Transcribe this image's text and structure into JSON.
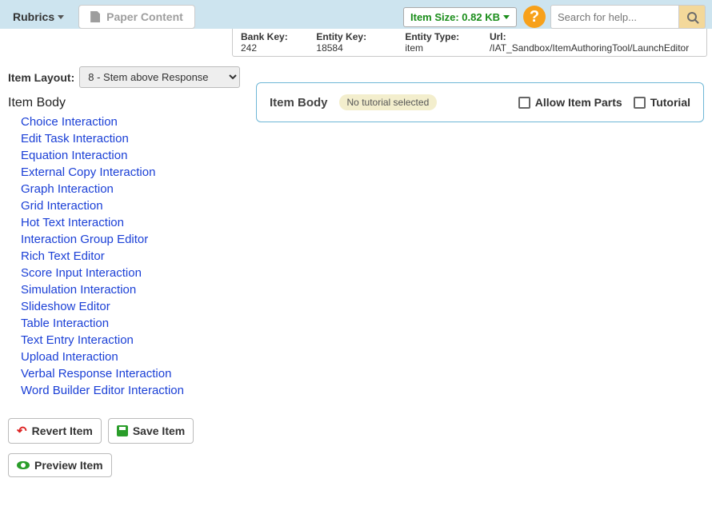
{
  "topbar": {
    "rubrics_label": "Rubrics",
    "paper_content_label": "Paper Content",
    "item_size_label": "Item Size: 0.82 KB",
    "help_symbol": "?"
  },
  "search": {
    "placeholder": "Search for help..."
  },
  "infobar": {
    "bank_key_label": "Bank Key:",
    "bank_key_value": "242",
    "entity_key_label": "Entity Key:",
    "entity_key_value": "18584",
    "entity_type_label": "Entity Type:",
    "entity_type_value": "item",
    "url_label": "Url:",
    "url_value": "/IAT_Sandbox/ItemAuthoringTool/LaunchEditor"
  },
  "layout": {
    "label": "Item Layout:",
    "selected": "8 - Stem above Response"
  },
  "body_heading": "Item Body",
  "interactions": [
    "Choice Interaction",
    "Edit Task Interaction",
    "Equation Interaction",
    "External Copy Interaction",
    "Graph Interaction",
    "Grid Interaction",
    "Hot Text Interaction",
    "Interaction Group Editor",
    "Rich Text Editor",
    "Score Input Interaction",
    "Simulation Interaction",
    "Slideshow Editor",
    "Table Interaction",
    "Text Entry Interaction",
    "Upload Interaction",
    "Verbal Response Interaction",
    "Word Builder Editor Interaction"
  ],
  "buttons": {
    "revert": "Revert Item",
    "save": "Save Item",
    "preview": "Preview Item"
  },
  "panel": {
    "title": "Item Body",
    "no_tutorial": "No tutorial selected",
    "allow_parts": "Allow Item Parts",
    "tutorial": "Tutorial"
  }
}
